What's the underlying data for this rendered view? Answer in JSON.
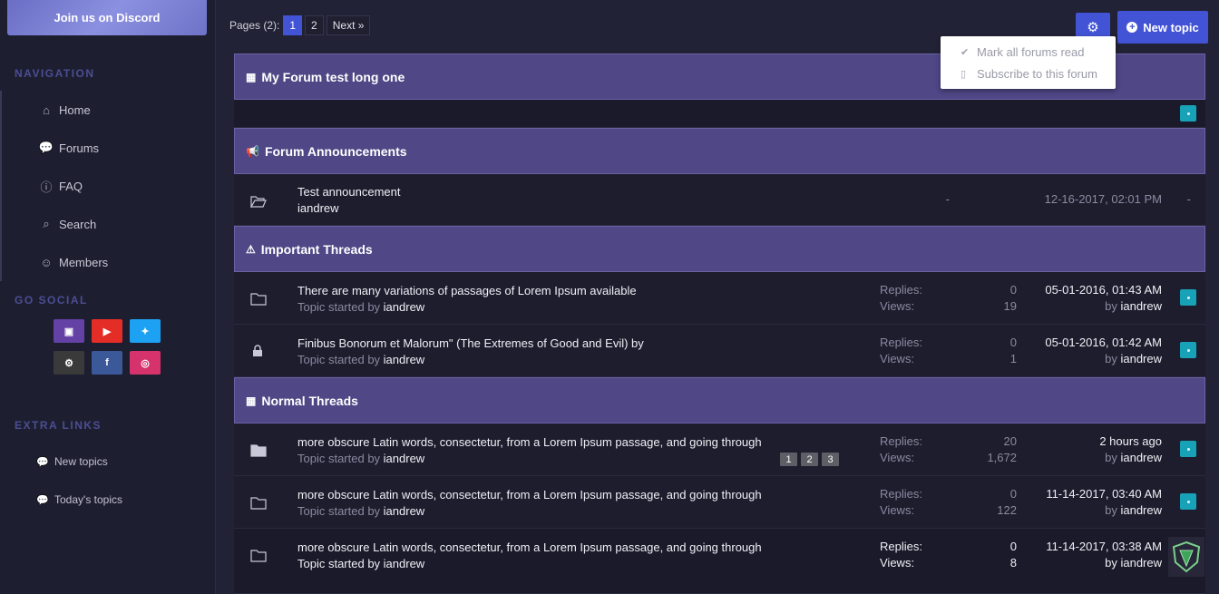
{
  "sidebar": {
    "discord_label": "Join us on Discord",
    "nav_heading": "NAVIGATION",
    "nav_items": [
      {
        "label": "Home",
        "icon": "home-icon"
      },
      {
        "label": "Forums",
        "icon": "comments-icon"
      },
      {
        "label": "FAQ",
        "icon": "question-circle-icon"
      },
      {
        "label": "Search",
        "icon": "search-icon"
      },
      {
        "label": "Members",
        "icon": "user-circle-icon"
      }
    ],
    "social_heading": "GO SOCIAL",
    "social": [
      {
        "name": "twitch-icon",
        "color": "#6441a5"
      },
      {
        "name": "youtube-icon",
        "color": "#e52d27"
      },
      {
        "name": "twitter-icon",
        "color": "#1da1f2"
      },
      {
        "name": "steam-icon",
        "color": "#3a3a3a"
      },
      {
        "name": "facebook-icon",
        "color": "#3b5998"
      },
      {
        "name": "instagram-icon",
        "color": "#d6336c"
      }
    ],
    "extra_heading": "EXTRA LINKS",
    "extra_items": [
      {
        "label": "New topics",
        "icon": "comments-icon"
      },
      {
        "label": "Today's topics",
        "icon": "comments-icon"
      }
    ]
  },
  "pagination": {
    "label": "Pages (2):",
    "pages": [
      "1",
      "2"
    ],
    "active": "1",
    "next": "Next »"
  },
  "toolbar": {
    "new_topic": "New topic",
    "dropdown": [
      "Mark all forums read",
      "Subscribe to this forum"
    ]
  },
  "sections": {
    "subforum": "My Forum test long one",
    "announcements": "Forum Announcements",
    "important": "Important Threads",
    "normal": "Normal Threads"
  },
  "announcement": {
    "title": "Test announcement",
    "author": "iandrew",
    "dash1": "-",
    "date": "12-16-2017, 02:01 PM",
    "dash2": "-"
  },
  "labels": {
    "replies": "Replies:",
    "views": "Views:",
    "started_by": "Topic started by",
    "by": "by"
  },
  "important_threads": [
    {
      "title": "There are many variations of passages of Lorem Ipsum available",
      "author": "iandrew",
      "replies": "0",
      "views": "19",
      "last_date": "05-01-2016, 01:43 AM",
      "last_by": "iandrew",
      "icon": "folder-open-icon"
    },
    {
      "title": "Finibus Bonorum et Malorum\" (The Extremes of Good and Evil) by",
      "author": "iandrew",
      "replies": "0",
      "views": "1",
      "last_date": "05-01-2016, 01:42 AM",
      "last_by": "iandrew",
      "icon": "lock-icon"
    }
  ],
  "normal_threads": [
    {
      "title": "more obscure Latin words, consectetur, from a Lorem Ipsum passage, and going through",
      "author": "iandrew",
      "replies": "20",
      "views": "1,672",
      "last_date": "2 hours ago",
      "last_by": "iandrew",
      "pages": [
        "1",
        "2",
        "3"
      ]
    },
    {
      "title": "more obscure Latin words, consectetur, from a Lorem Ipsum passage, and going through",
      "author": "iandrew",
      "replies": "0",
      "views": "122",
      "last_date": "11-14-2017, 03:40 AM",
      "last_by": "iandrew"
    },
    {
      "title": "more obscure Latin words, consectetur, from a Lorem Ipsum passage, and going through",
      "author": "iandrew",
      "replies": "0",
      "views": "8",
      "last_date": "11-14-2017, 03:38 AM",
      "last_by": "iandrew"
    }
  ]
}
